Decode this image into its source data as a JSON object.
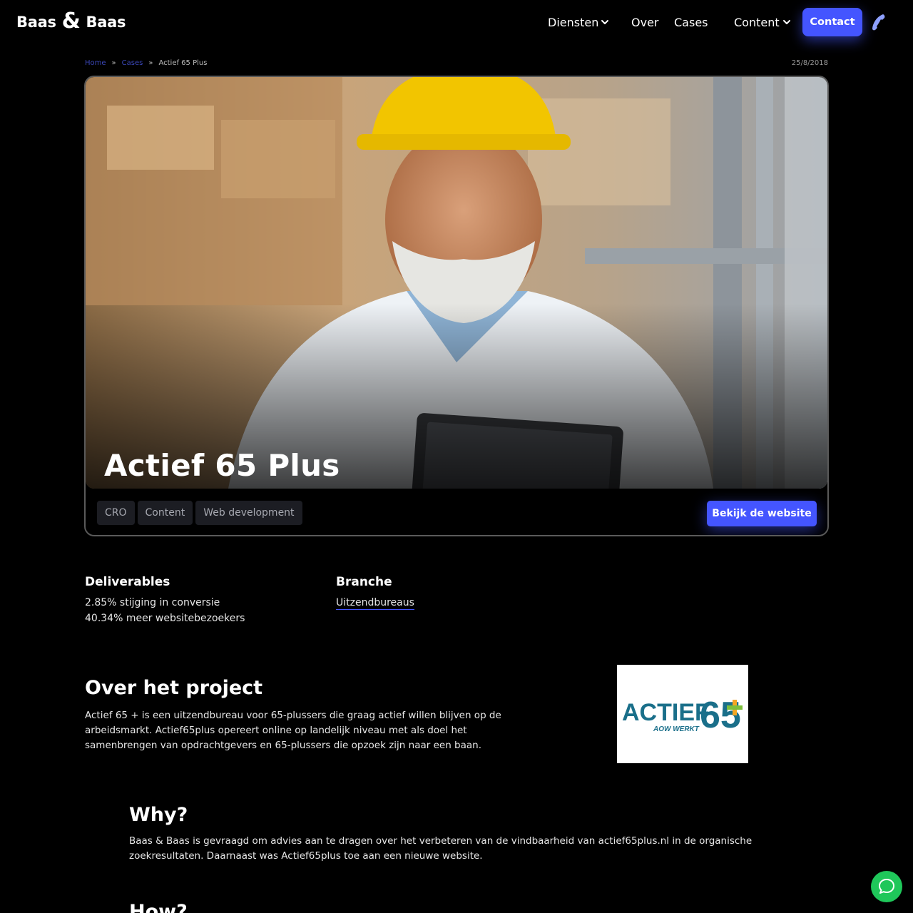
{
  "brand": {
    "left": "Baas",
    "amp": "&",
    "right": "Baas"
  },
  "nav": {
    "items": [
      {
        "label": "Diensten",
        "dropdown": true
      },
      {
        "label": "Over",
        "dropdown": false
      },
      {
        "label": "Cases",
        "dropdown": false
      },
      {
        "label": "Content",
        "dropdown": true
      }
    ],
    "contact_label": "Contact"
  },
  "breadcrumb": {
    "home": "Home",
    "sep": "»",
    "cases": "Cases",
    "current": "Actief 65 Plus"
  },
  "date": "25/8/2018",
  "hero": {
    "title": "Actief 65 Plus",
    "tags": [
      "CRO",
      "Content",
      "Web development"
    ],
    "cta_label": "Bekijk de website"
  },
  "info": {
    "deliverables_title": "Deliverables",
    "deliverables": [
      "2.85% stijging in conversie",
      "40.34% meer websitebezoekers"
    ],
    "branche_title": "Branche",
    "branche": "Uitzendbureaus"
  },
  "about": {
    "title": "Over het project",
    "text": "Actief 65 + is een uitzendbureau voor 65-plussers die graag actief willen blijven op de arbeidsmarkt. Actief65plus opereert online op landelijk niveau met als doel het samenbrengen van opdrachtgevers en 65-plussers die opzoek zijn naar een baan.",
    "logo_main": "ACTIEF",
    "logo_num": "65",
    "logo_sub": "AOW WERKT"
  },
  "why": {
    "title": "Why?",
    "text": "Baas & Baas is gevraagd om advies aan te dragen over het verbeteren van de vindbaarheid van actief65plus.nl in de organische zoekresultaten. Daarnaast was Actief65plus toe aan een nieuwe website."
  },
  "how": {
    "title": "How?"
  },
  "colors": {
    "accent": "#4455ff",
    "chat": "#1fc75a",
    "logo_blue": "#1a6f8a"
  }
}
